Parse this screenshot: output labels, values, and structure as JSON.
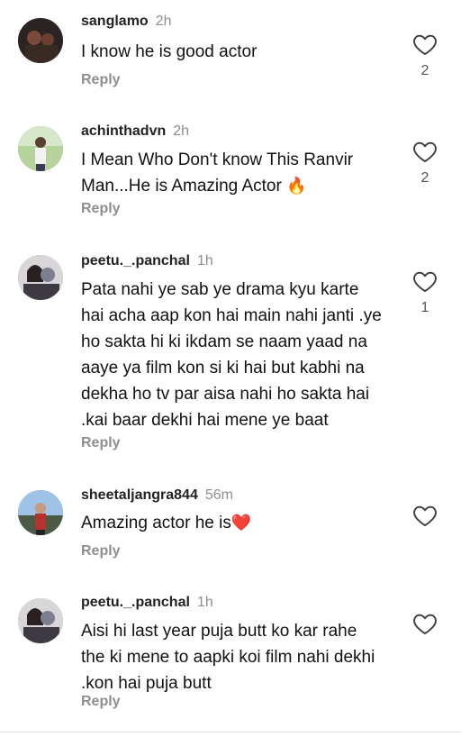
{
  "comments": [
    {
      "username": "sanglamo",
      "time": "2h",
      "text": "I know he is good actor",
      "reply_label": "Reply",
      "likes": "2",
      "avatar_colors": [
        "#2b2422",
        "#7a4a3a"
      ]
    },
    {
      "username": "achinthadvn",
      "time": "2h",
      "text": "I Mean Who Don't know This Ranvir Man...He is Amazing Actor",
      "emoji": "🔥",
      "reply_label": "Reply",
      "likes": "2",
      "avatar_colors": [
        "#9fc48a",
        "#4d6b3a"
      ]
    },
    {
      "username": "peetu._.panchal",
      "time": "1h",
      "text": "Pata nahi ye sab ye drama kyu karte hai acha aap kon hai main nahi janti .ye ho sakta hi ki ikdam se naam yaad na aaye ya film kon si ki hai but kabhi na dekha ho tv par aisa nahi ho sakta hai .kai baar dekhi hai mene ye baat",
      "reply_label": "Reply",
      "likes": "1",
      "avatar_colors": [
        "#c9c4c8",
        "#5a4f5a"
      ]
    },
    {
      "username": "sheetaljangra844",
      "time": "56m",
      "text": "Amazing actor he is",
      "emoji": "❤️",
      "reply_label": "Reply",
      "likes": "",
      "avatar_colors": [
        "#a9c8e8",
        "#3a4a5c"
      ]
    },
    {
      "username": "peetu._.panchal",
      "time": "1h",
      "text": "Aisi hi last year puja butt ko kar rahe the ki mene to aapki koi film nahi dekhi .kon hai puja butt",
      "reply_label": "Reply",
      "likes": "",
      "avatar_colors": [
        "#c9c4c8",
        "#5a4f5a"
      ]
    }
  ],
  "icons": {
    "like": "heart-outline-icon"
  }
}
